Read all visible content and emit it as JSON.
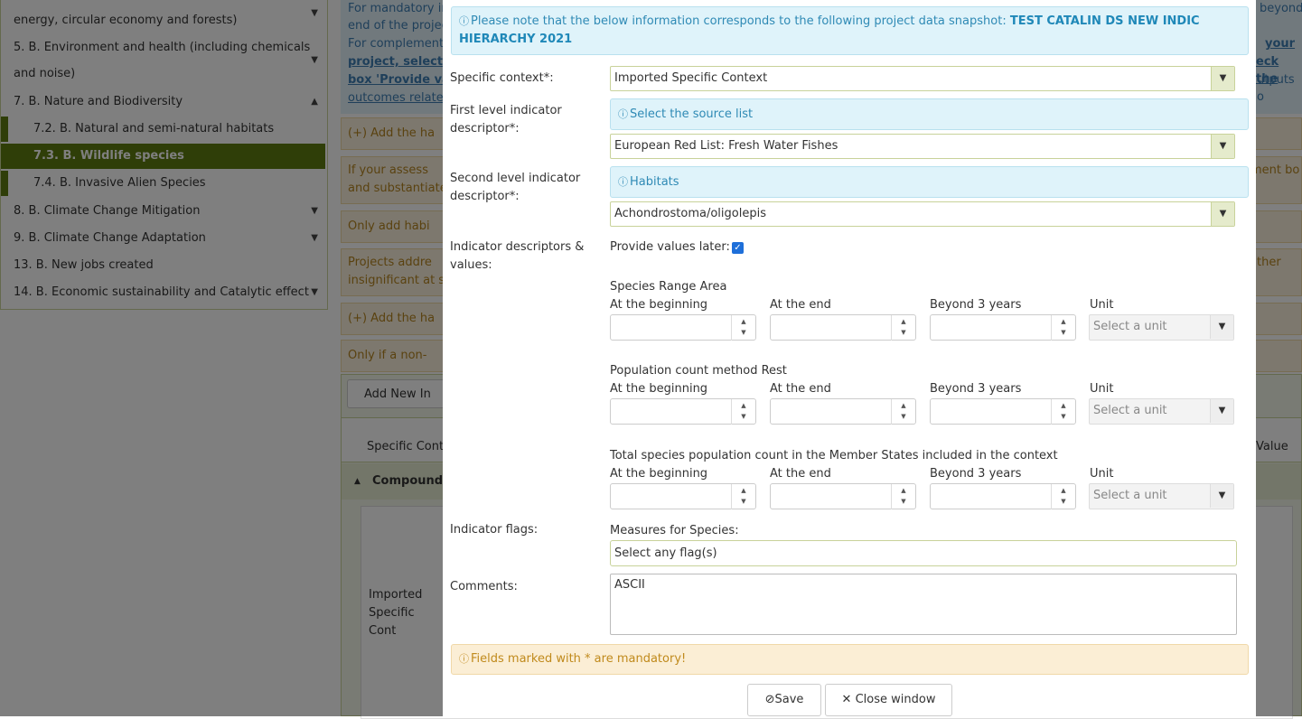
{
  "sidebar": {
    "items": [
      {
        "label": "energy, circular economy and forests)"
      },
      {
        "label": "5. B. Environment and health (including chemicals"
      },
      {
        "label": "and noise)"
      },
      {
        "label": "7. B. Nature and Biodiversity"
      },
      {
        "label": "7.2. B. Natural and semi-natural habitats"
      },
      {
        "label": "7.3. B. Wildlife species"
      },
      {
        "label": "7.4. B. Invasive Alien Species"
      },
      {
        "label": "8. B. Climate Change Mitigation"
      },
      {
        "label": "9. B. Climate Change Adaptation"
      },
      {
        "label": "13. B. New jobs created"
      },
      {
        "label": "14. B. Economic sustainability and Catalytic effect"
      }
    ]
  },
  "background": {
    "info_lines": [
      "For mandatory in",
      "end of the projec",
      "For complementa",
      "project, select th",
      "box 'Provide valu",
      "outcomes relate"
    ],
    "right_fragments": [
      "beyond",
      "your",
      "eck the",
      "utputs o"
    ],
    "notices": [
      "(+) Add the ha",
      "If your assess",
      "and substantiate",
      "Only add habi",
      "Projects addre",
      "insignificant at s",
      "(+) Add the ha",
      "Only if a non-"
    ],
    "notice_right": [
      "ment bo",
      "ther"
    ],
    "add_new_label": "Add New In",
    "col_specific": "Specific Cont",
    "col_value": "Value",
    "compound_label": "Compound V",
    "row_specific": "Imported Specific Cont"
  },
  "modal": {
    "snapshot_note": "Please note that the below information corresponds to the following project data snapshot:",
    "snapshot_name": "TEST CATALIN DS NEW INDIC HIERARCHY 2021",
    "specific_context_label": "Specific context*:",
    "specific_context_value": "Imported Specific Context",
    "first_level_label": "First level indicator descriptor*:",
    "first_level_hint": "Select the source list",
    "first_level_value": "European Red List: Fresh Water Fishes",
    "second_level_label": "Second level indicator descriptor*:",
    "second_level_hint": "Habitats",
    "second_level_value": "Achondrostoma/oligolepis",
    "descriptors_label": "Indicator descriptors & values:",
    "provide_later_label": "Provide values later:",
    "provide_later_checked": true,
    "sections": [
      {
        "title": "Species Range Area"
      },
      {
        "title": "Population count method Rest"
      },
      {
        "title": "Total species population count in the Member States included in the context"
      }
    ],
    "col_beginning": "At the beginning",
    "col_end": "At the end",
    "col_beyond": "Beyond 3 years",
    "col_unit": "Unit",
    "unit_placeholder": "Select a unit",
    "flags_label": "Indicator flags:",
    "measures_label": "Measures for Species:",
    "flags_placeholder": "Select any flag(s)",
    "comments_label": "Comments:",
    "comments_value": "ASCII",
    "mandatory_note": "Fields marked with * are mandatory!",
    "save_label": "Save",
    "close_label": "Close window"
  },
  "colors": {
    "sidebar_active": "#5f7d10",
    "info_text": "#2f8ab5",
    "warning_text": "#c08a1c",
    "checkbox": "#1e6fd9"
  }
}
